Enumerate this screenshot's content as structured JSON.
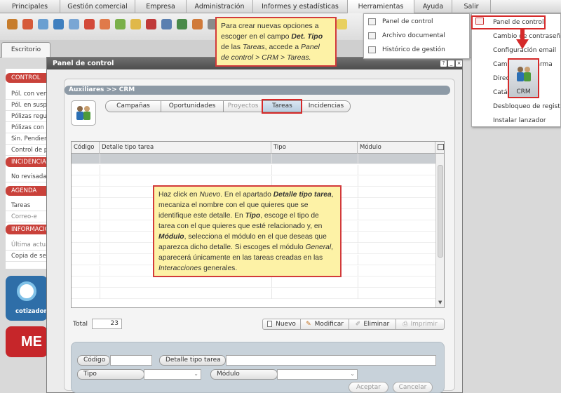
{
  "top_menu": [
    "Principales",
    "Gestión comercial",
    "Empresa",
    "Administración",
    "Informes y estadísticas",
    "Herramientas",
    "Ayuda",
    "Salir"
  ],
  "desktop_tab": "Escritorio",
  "sidebar": {
    "control_header": "CONTROL",
    "control_items": [
      "Pól. con vencimiento",
      "Pól. en suspenso",
      "Pólizas regularizadas",
      "Pólizas con siniestro",
      "Sin. Pendientes",
      "Control de pagos"
    ],
    "incidencias_header": "INCIDENCIAS",
    "incidencias_items": [
      "No revisadas"
    ],
    "agenda_header": "AGENDA",
    "agenda_items": [
      "Tareas",
      "Correo-e"
    ],
    "info_header": "INFORMACIÓN",
    "info_items": [
      "Última actualización",
      "Copia de seguridad"
    ],
    "brand_label": "cotizador",
    "brand2": "ME"
  },
  "window": {
    "title": "Panel de control",
    "breadcrumb": "Auxiliares >> CRM",
    "tabs": [
      "Campañas",
      "Oportunidades",
      "Proyectos",
      "Tareas",
      "Incidencias"
    ],
    "active_tab": "Tareas",
    "columns": [
      "Código",
      "Detalle tipo tarea",
      "Tipo",
      "Módulo"
    ],
    "total_label": "Total",
    "total_value": "23",
    "buttons": {
      "nuevo": "Nuevo",
      "modificar": "Modificar",
      "eliminar": "Eliminar",
      "imprimir": "Imprimir"
    },
    "form": {
      "codigo_label": "Código",
      "detalle_label": "Detalle tipo tarea",
      "tipo_label": "Tipo",
      "modulo_label": "Módulo",
      "aceptar": "Aceptar",
      "cancelar": "Cancelar"
    }
  },
  "herramientas_menu": [
    "Panel de control",
    "Archivo documental",
    "Histórico de gestión"
  ],
  "submenu": [
    "Panel de control",
    "Cambio de contraseña",
    "Configuración email",
    "Campos de alarma",
    "Directorio",
    "Catálogos",
    "Desbloqueo de registro",
    "Instalar lanzador"
  ],
  "crm_icon_label": "CRM",
  "callout_top": {
    "line1": "Para crear nuevas opciones a",
    "line2a": "escoger en el campo ",
    "line2b": "Det. Tipo",
    "line3a": "de las ",
    "line3b": "Tareas",
    "line3c": ", accede a ",
    "line3d": "Panel",
    "line4": "de control > CRM > Tareas."
  },
  "callout_mid": {
    "s1": "Haz click en ",
    "s2": "Nuevo",
    "s3": ". En el apartado ",
    "s4": "Detalle tipo tarea",
    "s5": ", mecaniza el nombre con el que quieres que se identifique este detalle. En ",
    "s6": "Tipo",
    "s7": ", escoge el tipo de tarea con el que quieres que esté relacionado y, en ",
    "s8": "Módulo",
    "s9": ", selecciona el módulo en el que deseas que aparezca dicho detalle. Si escoges el módulo ",
    "s10": "General",
    "s11": ", aparecerá únicamente en las tareas creadas en las ",
    "s12": "Interacciones",
    "s13": " generales."
  },
  "colors": {
    "accent_red": "#d23a3a",
    "callout_bg": "#fdf2a6",
    "header_dark": "#5a5a5a",
    "breadcrumb": "#8d9aa6"
  }
}
